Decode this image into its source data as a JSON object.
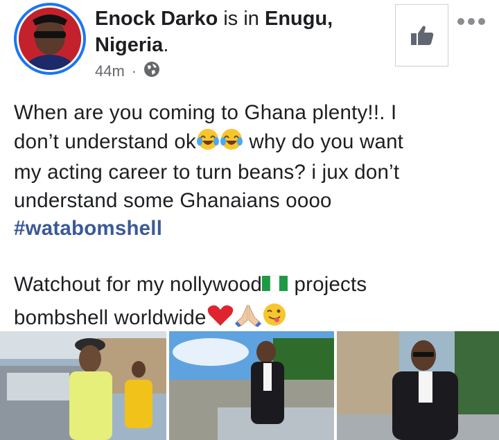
{
  "post": {
    "author": "Enock Darko",
    "connector": " is in ",
    "location_line1": "Enugu,",
    "location_line2": "Nigeria",
    "location_period": ".",
    "time": "44m",
    "separator": "·",
    "privacy_icon": "globe-icon",
    "text": {
      "line1": "When are you coming to Ghana plenty!!. I",
      "line2a": "don’t understand ok",
      "line2b": " why do you want",
      "line3": "my acting career to turn beans? i jux don’t",
      "line4": "understand some Ghanaians oooo",
      "hashtag": "#watabomshell",
      "line6": "Watchout for my nollywood",
      "line6b": " projects",
      "line7": "bombshell worldwide"
    },
    "emojis": [
      "laughing-tears-emoji",
      "laughing-tears-emoji",
      "nigeria-flag-emoji",
      "red-heart-emoji",
      "praying-hands-emoji",
      "winking-tongue-emoji"
    ]
  },
  "actions": {
    "like_icon": "thumbs-up-icon",
    "more_icon": "more-options-icon"
  },
  "colors": {
    "accent": "#1877f2",
    "hashtag": "#3b5998",
    "meta": "#65676b"
  },
  "photos": [
    "photo-man-yellow-shirt-car",
    "photo-man-suit-car",
    "photo-man-suit-sunglasses"
  ]
}
